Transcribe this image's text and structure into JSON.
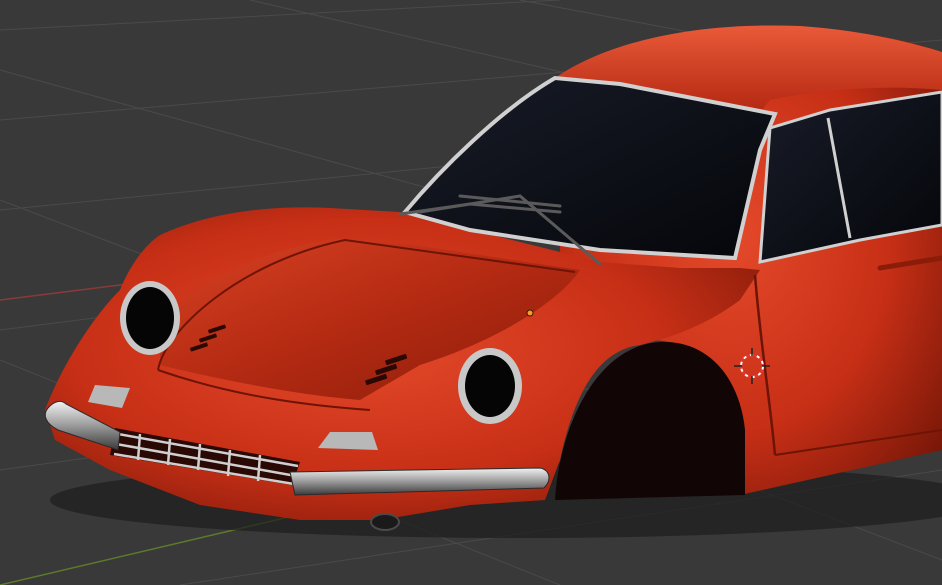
{
  "viewport": {
    "background_color": "#393939",
    "grid_color": "#4a4a4a",
    "x_axis_color": "#8a3a3a",
    "y_axis_color": "#5b7a2a"
  },
  "model": {
    "paint_color": "#d9391c",
    "paint_dark_color": "#7a1608",
    "glass_color": "#0a0c14",
    "chrome_color": "#d8d8d8"
  },
  "icons": {
    "origin": "object-origin-icon",
    "cursor": "3d-cursor-icon"
  }
}
